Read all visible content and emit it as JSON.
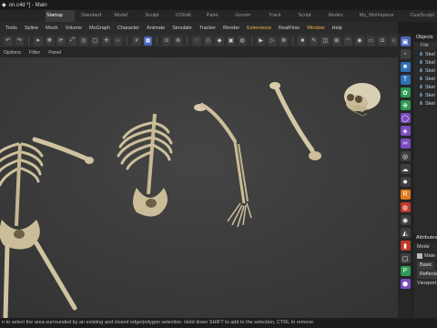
{
  "window": {
    "title": "on.c4d *] - Main"
  },
  "layouts": [
    "Startup",
    "Standard",
    "Model",
    "Sculpt",
    "UVEdit",
    "Paint",
    "Groom",
    "Track",
    "Script",
    "Nodes",
    "My_Workspace",
    "CustSculpt"
  ],
  "active_layout": "Startup",
  "menu": [
    "Tools",
    "Spline",
    "Mesh",
    "Volume",
    "MoGraph",
    "Character",
    "Animate",
    "Simulate",
    "Tracker",
    "Render",
    "Extensions",
    "RealFlow",
    "Window",
    "Help"
  ],
  "viewport_menu": [
    "Options",
    "Filter",
    "Panel"
  ],
  "objects_panel": {
    "title": "Objects",
    "menu": "File",
    "items": [
      "Skel",
      "Skel",
      "Skel",
      "Skel",
      "Skel",
      "Skel",
      "Skel"
    ]
  },
  "attributes_panel": {
    "title": "Attributes",
    "mode_label": "Mode",
    "material_label": "Mate",
    "tabs": [
      "Basic",
      "Ref"
    ],
    "reflectance_label": "Reflectan",
    "viewport_label": "Viewport"
  },
  "status_text": "n to select the area surrounded by an existing and closed edge/polygon selection. Hold down SHIFT to add to the selection, CTRL to remove.",
  "colors": {
    "accent": "#4a64b8",
    "highlight": "#f0b24a",
    "viewport_bg": "#3d3d3d",
    "bone": "#cfc3a4"
  }
}
